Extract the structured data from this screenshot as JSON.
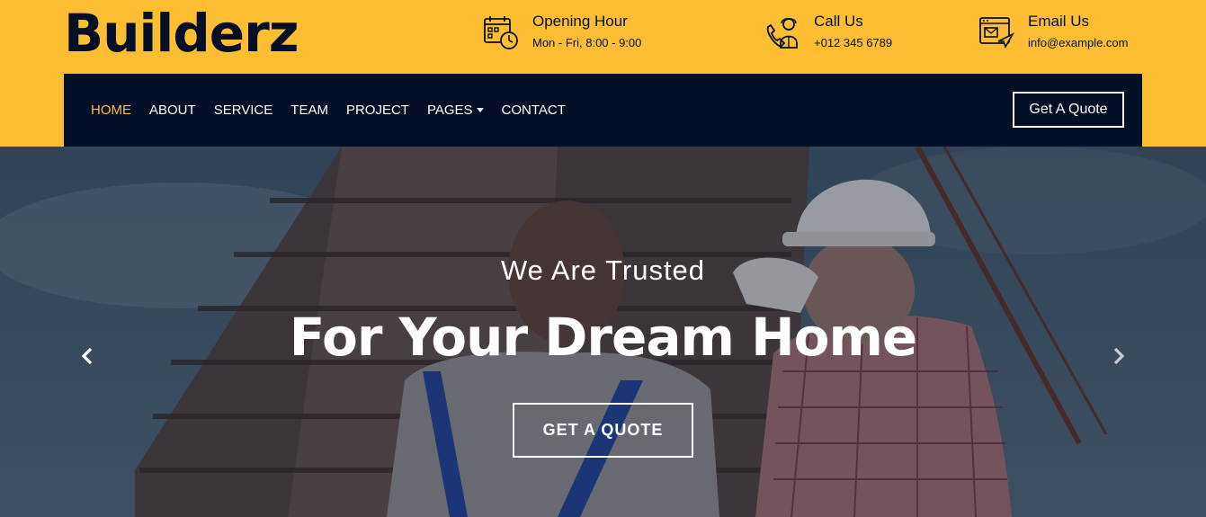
{
  "brand": {
    "name": "Builderz"
  },
  "top_info": [
    {
      "title": "Opening Hour",
      "detail": "Mon - Fri, 8:00 - 9:00",
      "icon": "calendar-clock-icon"
    },
    {
      "title": "Call Us",
      "detail": "+012 345 6789",
      "icon": "phone-support-icon"
    },
    {
      "title": "Email Us",
      "detail": "info@example.com",
      "icon": "email-icon"
    }
  ],
  "nav": {
    "items": [
      "HOME",
      "ABOUT",
      "SERVICE",
      "TEAM",
      "PROJECT",
      "PAGES",
      "CONTACT"
    ],
    "active": "HOME",
    "cta": "Get A Quote"
  },
  "hero": {
    "subtitle": "We Are Trusted",
    "title": "For Your Dream Home",
    "button": "GET A QUOTE",
    "prev_icon": "chevron-left-icon",
    "next_icon": "chevron-right-icon"
  },
  "colors": {
    "accent": "#fdbe33",
    "dark": "#030f27",
    "white": "#ffffff"
  }
}
